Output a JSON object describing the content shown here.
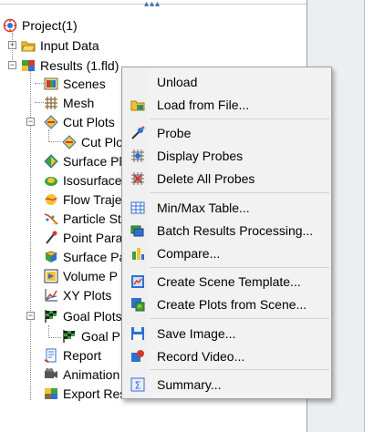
{
  "tree": {
    "root": "Project(1)",
    "items": [
      {
        "label": "Input Data",
        "icon": "folder-open-icon"
      },
      {
        "label": "Results (1.fld)",
        "icon": "results-icon"
      },
      {
        "label": "Scenes",
        "icon": "scenes-icon"
      },
      {
        "label": "Mesh",
        "icon": "mesh-icon"
      },
      {
        "label": "Cut Plots",
        "icon": "cut-plot-icon"
      },
      {
        "label": "Cut Plo",
        "icon": "cut-plot-icon"
      },
      {
        "label": "Surface Pl",
        "icon": "surface-plot-icon"
      },
      {
        "label": "Isosurface",
        "icon": "isosurface-icon"
      },
      {
        "label": "Flow Traje",
        "icon": "flow-trajectory-icon"
      },
      {
        "label": "Particle St",
        "icon": "particle-study-icon"
      },
      {
        "label": "Point Para",
        "icon": "point-parameter-icon"
      },
      {
        "label": "Surface Pa",
        "icon": "surface-parameter-icon"
      },
      {
        "label": "Volume P",
        "icon": "volume-parameter-icon"
      },
      {
        "label": "XY Plots",
        "icon": "xy-plot-icon"
      },
      {
        "label": "Goal Plots",
        "icon": "goal-plot-icon"
      },
      {
        "label": "Goal P",
        "icon": "goal-plot-icon"
      },
      {
        "label": "Report",
        "icon": "report-icon"
      },
      {
        "label": "Animation",
        "icon": "animation-icon"
      },
      {
        "label": "Export Results",
        "icon": "export-results-icon"
      }
    ]
  },
  "menu": {
    "items": [
      {
        "label": "Unload",
        "icon": "none"
      },
      {
        "label": "Load from File...",
        "icon": "load-folder-icon"
      },
      {
        "label": "Probe",
        "icon": "probe-icon"
      },
      {
        "label": "Display Probes",
        "icon": "display-probes-icon"
      },
      {
        "label": "Delete All Probes",
        "icon": "delete-probes-icon"
      },
      {
        "label": "Min/Max Table...",
        "icon": "table-icon"
      },
      {
        "label": "Batch Results Processing...",
        "icon": "batch-icon"
      },
      {
        "label": "Compare...",
        "icon": "compare-icon"
      },
      {
        "label": "Create Scene Template...",
        "icon": "scene-template-icon"
      },
      {
        "label": "Create Plots from Scene...",
        "icon": "plots-from-scene-icon"
      },
      {
        "label": "Save Image...",
        "icon": "save-icon"
      },
      {
        "label": "Record Video...",
        "icon": "record-video-icon"
      },
      {
        "label": "Summary...",
        "icon": "summary-icon"
      }
    ]
  },
  "colors": {
    "menu_bg": "#f2f2f2",
    "accent_blue": "#2f6fd1",
    "folder_yellow": "#f2c230",
    "green": "#3aa33a",
    "red": "#d23a2a"
  }
}
